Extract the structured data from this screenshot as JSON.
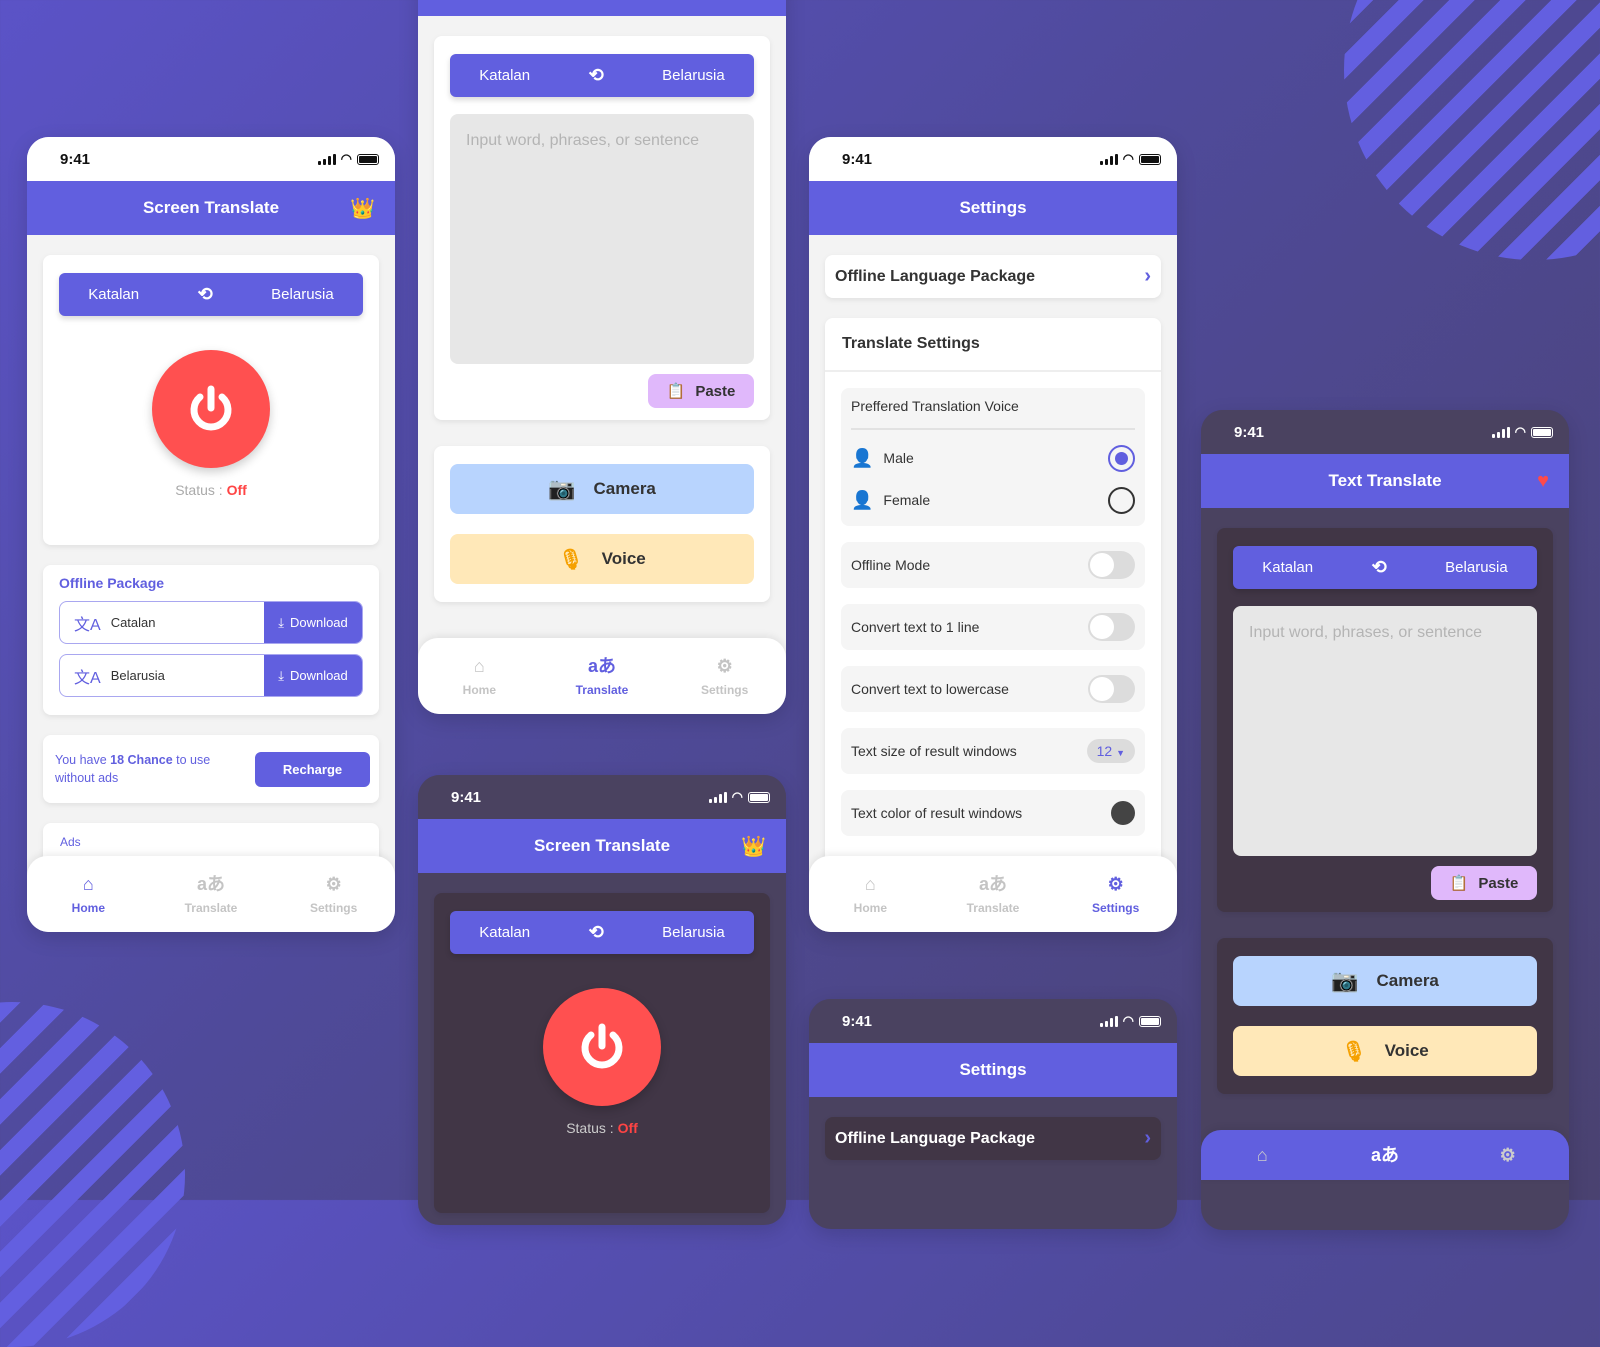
{
  "colors": {
    "primary": "#615fdf",
    "danger": "#ff5050",
    "paste_bg": "#e0b8fb",
    "camera_bg": "#b8d4fe",
    "voice_bg": "#ffe8b8"
  },
  "status_time": "9:41",
  "lang_bar": {
    "source": "Katalan",
    "target": "Belarusia",
    "swap_icon": "swap-icon"
  },
  "nav": {
    "home": "Home",
    "translate": "Translate",
    "settings": "Settings",
    "translate_glyph": "aあ"
  },
  "screen_home": {
    "title": "Screen Translate",
    "status_label": "Status :",
    "status_value": "Off",
    "offline_package": {
      "heading": "Offline Package",
      "items": [
        {
          "name": "Catalan",
          "action": "Download"
        },
        {
          "name": "Belarusia",
          "action": "Download"
        }
      ]
    },
    "chance": {
      "prefix": "You have ",
      "count": "18 Chance",
      "suffix": " to use without ads",
      "button": "Recharge"
    },
    "ads_label": "Ads"
  },
  "screen_translate": {
    "placeholder": "Input word, phrases, or sentence",
    "paste": "Paste",
    "camera": "Camera",
    "voice": "Voice"
  },
  "screen_settings": {
    "title": "Settings",
    "offline_language_package": "Offline Language Package",
    "translate_settings": "Translate Settings",
    "voice_heading": "Preffered Translation Voice",
    "voices": [
      {
        "label": "Male",
        "selected": true
      },
      {
        "label": "Female",
        "selected": false
      }
    ],
    "offline_mode": {
      "label": "Offline Mode",
      "on": false
    },
    "one_line": {
      "label": "Convert text to 1 line",
      "on": false
    },
    "lowercase": {
      "label": "Convert text to lowercase",
      "on": false
    },
    "text_size": {
      "label": "Text size of result windows",
      "value": "12"
    },
    "text_color": {
      "label": "Text color of result windows",
      "value": "#444444"
    }
  },
  "screen_text_translate": {
    "title": "Text Translate"
  }
}
